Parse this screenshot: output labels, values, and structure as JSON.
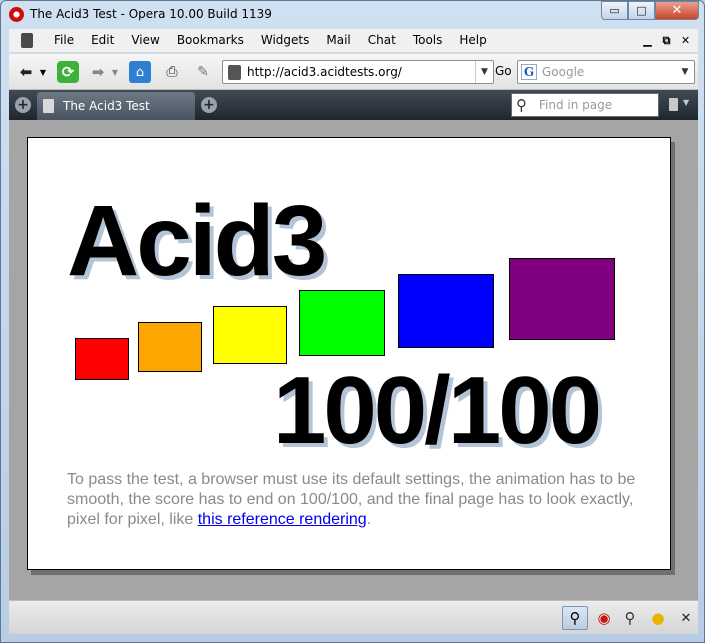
{
  "window": {
    "title": "The Acid3 Test - Opera 10.00 Build 1139",
    "minimize": "▭",
    "maximize": "□",
    "close": "✕"
  },
  "menu": {
    "items": [
      {
        "label": "File"
      },
      {
        "label": "Edit"
      },
      {
        "label": "View"
      },
      {
        "label": "Bookmarks"
      },
      {
        "label": "Widgets"
      },
      {
        "label": "Mail"
      },
      {
        "label": "Chat"
      },
      {
        "label": "Tools"
      },
      {
        "label": "Help"
      }
    ],
    "mdi": [
      "▁",
      "⧉",
      "✕"
    ]
  },
  "nav": {
    "address": "http://acid3.acidtests.org/",
    "go_label": "Go",
    "search_engine": "G",
    "search_placeholder": "Google"
  },
  "tabs": {
    "active_label": "The Acid3 Test",
    "find_placeholder": "Find in page"
  },
  "page": {
    "title": "Acid3",
    "score": "100/100",
    "desc_text": "To pass the test, a browser must use its default settings, the animation has to be smooth, the score has to end on 100/100, and the final page has to look exactly, pixel for pixel, like ",
    "desc_link": "this reference rendering",
    "desc_end": ".",
    "boxes": [
      {
        "color": "#ff0000"
      },
      {
        "color": "#ffa500"
      },
      {
        "color": "#ffff00"
      },
      {
        "color": "#00ff00"
      },
      {
        "color": "#0000ff"
      },
      {
        "color": "#800080"
      }
    ]
  },
  "icons": [
    "zoom-icon",
    "opera-icon",
    "search-icon",
    "pacman-icon",
    "close-icon"
  ]
}
